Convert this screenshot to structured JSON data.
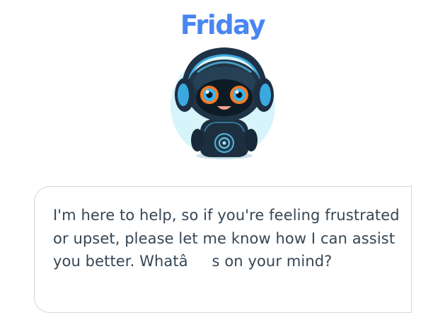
{
  "assistant": {
    "name": "Friday",
    "avatar_icon": "robot-avatar-icon",
    "brand_color": "#4a86f2"
  },
  "chat": {
    "message": "I'm here to help, so if you're feeling frustrated or upset, please let me know how I can assist you better. Whatâs on your mind?"
  }
}
